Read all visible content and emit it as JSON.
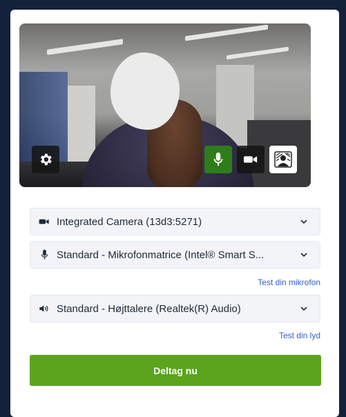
{
  "preview": {
    "controls": [
      {
        "icon": "gear-icon"
      },
      {
        "icon": "microphone-icon",
        "active_color": "#2e7d1a"
      },
      {
        "icon": "camera-icon"
      },
      {
        "icon": "background-effect-icon"
      }
    ]
  },
  "devices": {
    "camera": {
      "icon": "camera-icon",
      "selected": "Integrated Camera (13d3:5271)"
    },
    "microphone": {
      "icon": "microphone-icon",
      "selected": "Standard - Mikrofonmatrice (Intel® Smart S..."
    },
    "speaker": {
      "icon": "speaker-icon",
      "selected": "Standard - Højttalere (Realtek(R) Audio)"
    }
  },
  "links": {
    "test_mic": "Test din mikrofon",
    "test_sound": "Test din lyd"
  },
  "join_button": {
    "label": "Deltag nu",
    "color": "#5aa51c"
  },
  "colors": {
    "link": "#2e5bd1",
    "background": "#14213a"
  }
}
